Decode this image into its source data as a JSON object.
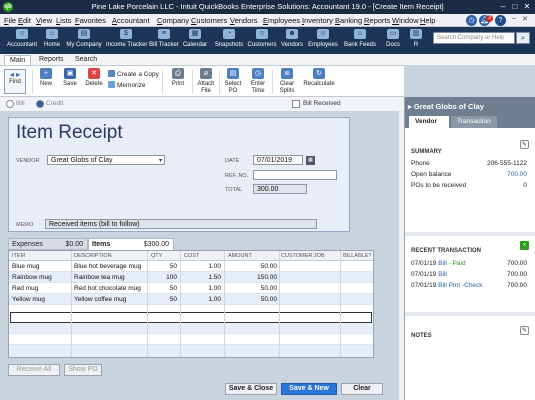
{
  "titlebar": {
    "logo": "qb",
    "title": "Pine Lake Porcelain LLC  - Intuit QuickBooks Enterprise Solutions: Accountant 19.0 - [Create Item Receipt]"
  },
  "menu": [
    "File",
    "Edit",
    "View",
    "Lists",
    "Favorites",
    "Accountant",
    "Company",
    "Customers",
    "Vendors",
    "Employees",
    "Inventory",
    "Banking",
    "Reports",
    "Window",
    "Help"
  ],
  "menu_badge": "3",
  "iconbar": [
    {
      "label": "Accountant",
      "icon": "accountant-icon"
    },
    {
      "label": "Home",
      "icon": "home-icon"
    },
    {
      "label": "My Company",
      "icon": "my-company-icon"
    },
    {
      "label": "Income Tracker",
      "icon": "income-tracker-icon"
    },
    {
      "label": "Bill Tracker",
      "icon": "bill-tracker-icon"
    },
    {
      "label": "Calendar",
      "icon": "calendar-icon"
    },
    {
      "label": "Snapshots",
      "icon": "snapshots-icon"
    },
    {
      "label": "Customers",
      "icon": "customers-icon"
    },
    {
      "label": "Vendors",
      "icon": "vendors-icon"
    },
    {
      "label": "Employees",
      "icon": "employees-icon"
    },
    {
      "label": "Bank Feeds",
      "icon": "bank-feeds-icon"
    },
    {
      "label": "Docs",
      "icon": "docs-icon"
    },
    {
      "label": "R",
      "icon": "reports-icon"
    }
  ],
  "search": {
    "placeholder": "Search Company or Help"
  },
  "ribbon_tabs": [
    "Main",
    "Reports",
    "Search"
  ],
  "ribbon": {
    "find": "Find",
    "new": "New",
    "save": "Save",
    "delete": "Delete",
    "create_copy": "Create a Copy",
    "memorize": "Memorize",
    "print": "Print",
    "attach_file": "Attach File",
    "select_po": "Select PO",
    "enter_time": "Enter Time",
    "clear_splits": "Clear Splits",
    "recalculate": "Recalculate"
  },
  "subbar": {
    "bill": "Bill",
    "credit": "Credit",
    "bill_received": "Bill Received"
  },
  "form": {
    "title": "Item Receipt",
    "vendor_label": "VENDOR",
    "vendor": "Great Globs of Clay",
    "date_label": "DATE",
    "date": "07/01/2019",
    "refno_label": "REF. NO.",
    "refno": "",
    "total_label": "TOTAL",
    "total": "300.00",
    "memo_label": "MEMO",
    "memo": "Received items (bill to follow)"
  },
  "tabs": {
    "expenses_label": "Expenses",
    "expenses_amount": "$0.00",
    "items_label": "Items",
    "items_amount": "$300.00"
  },
  "table": {
    "headers": [
      "ITEM",
      "DESCRIPTION",
      "QTY",
      "COST",
      "AMOUNT",
      "CUSTOMER:JOB",
      "BILLABLE?"
    ],
    "rows": [
      {
        "item": "Blue mug",
        "description": "Blue hot beverage mug",
        "qty": "50",
        "cost": "1.00",
        "amount": "50.00"
      },
      {
        "item": "Rainbow mug",
        "description": "Rainbow tea mug",
        "qty": "100",
        "cost": "1.50",
        "amount": "150.00"
      },
      {
        "item": "Red mug",
        "description": "Red hot chocolate mug",
        "qty": "50",
        "cost": "1.00",
        "amount": "50.00"
      },
      {
        "item": "Yellow mug",
        "description": "Yellow coffee mug",
        "qty": "50",
        "cost": "1.00",
        "amount": "50.00"
      }
    ]
  },
  "buttons": {
    "receive_all": "Receive All",
    "show_po": "Show PO",
    "save_close": "Save & Close",
    "save_new": "Save & New",
    "clear": "Clear"
  },
  "panel": {
    "title": "Great Globs of Clay",
    "tab_vendor": "Vendor",
    "tab_transaction": "Transaction",
    "summary_label": "SUMMARY",
    "phone_label": "Phone",
    "phone": "206-555-1122",
    "open_balance_label": "Open balance",
    "open_balance": "700.00",
    "pos_label": "POs to be received",
    "pos": "0",
    "recent_label": "RECENT TRANSACTION",
    "recent": [
      {
        "date": "07/01/19",
        "type": "Bill",
        "status": "Paid",
        "amount": "700.00"
      },
      {
        "date": "07/01/19",
        "type": "Bill",
        "status": "",
        "amount": "700.00"
      },
      {
        "date": "07/01/19",
        "type": "Bill Pmt -Check",
        "status": "",
        "amount": "700.00"
      }
    ],
    "notes_label": "NOTES"
  }
}
